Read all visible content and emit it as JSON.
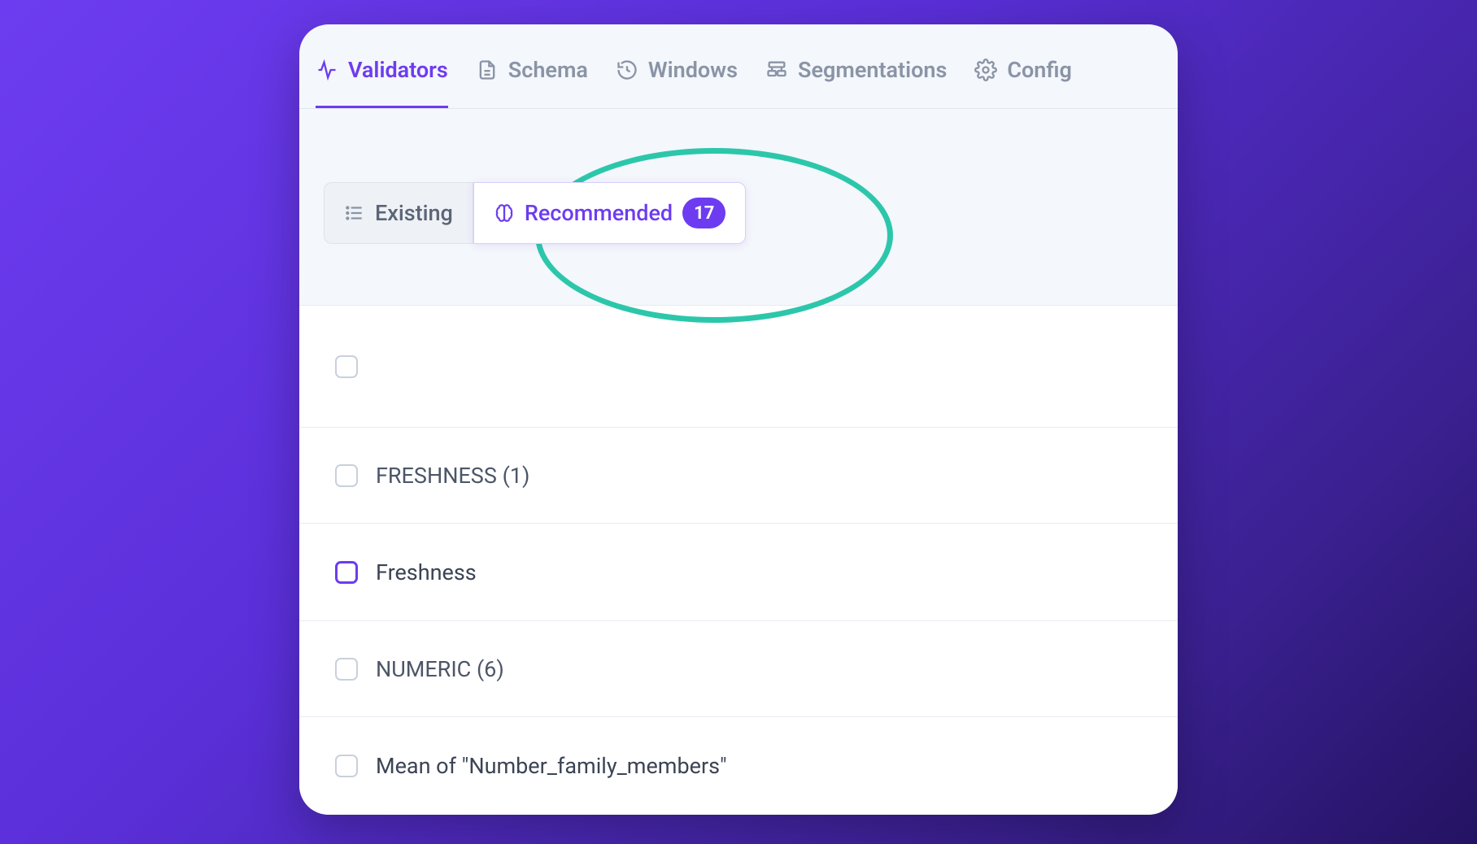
{
  "topnav": {
    "validators": "Validators",
    "schema": "Schema",
    "windows": "Windows",
    "segmentations": "Segmentations",
    "config": "Config"
  },
  "subtabs": {
    "existing": "Existing",
    "recommended": "Recommended",
    "recommended_count": "17"
  },
  "rows": {
    "group_freshness": "FRESHNESS (1)",
    "item_freshness": "Freshness",
    "group_numeric": "NUMERIC (6)",
    "item_mean_family": "Mean of \"Number_family_members\""
  }
}
